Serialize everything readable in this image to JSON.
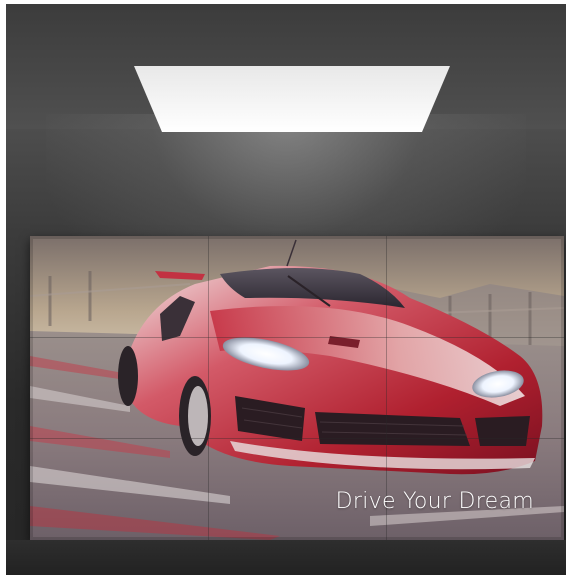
{
  "display": {
    "tagline": "Drive Your Dream"
  },
  "colors": {
    "room": "#3a3a3a",
    "car_body": "#c0283a",
    "sky": "#b9a78f"
  },
  "scene": {
    "subject": "red sports car on race track",
    "wall_grid": "3x3"
  }
}
